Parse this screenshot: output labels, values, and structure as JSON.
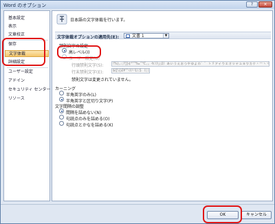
{
  "window": {
    "title": "Word のオプション",
    "help_label": "?",
    "close_label": "✕"
  },
  "sidebar": {
    "items": [
      {
        "label": "基本設定"
      },
      {
        "label": "表示"
      },
      {
        "label": "文章校正"
      },
      {
        "label": "保存"
      },
      {
        "label": "文字体裁"
      },
      {
        "label": "詳細設定"
      },
      {
        "label": "ユーザー設定"
      },
      {
        "label": "アドイン"
      },
      {
        "label": "セキュリティ センター"
      },
      {
        "label": "リソース"
      }
    ],
    "selected_index": 4
  },
  "content": {
    "header_text": "日本語の文字体裁を行います。",
    "section_label": "文字体裁オプションの適用先(E):",
    "apply_to": {
      "value": "文書 1",
      "icon": "document-icon"
    },
    "kinsoku": {
      "group_label": "禁則文字の設定",
      "level_label": "高レベル(I)",
      "custom_label": "ユーザー設定(U)",
      "line_start_label": "行頭禁則文字(S):",
      "line_start_value": "!%),.:;?]}¢°’”‰′″℃、。々〉》」』】〕ぁぃぅぇぉっゃゅょゎ゛゜ゝゞァィゥェォッャュョヮヵヶ・ーヽヾ！％），．：；？］｝｡｣､･ｧｨｩｪｫｬｭｮｯｰﾞﾟ￠",
      "line_end_label": "行末禁則文字(E):",
      "line_end_value": "$([\\{£¥‘“〈《「『【〔＄（［｛｢￡￥",
      "notice": "禁則文字は変更されていません。"
    },
    "kerning": {
      "group_label": "カーニング",
      "option1": "半角英字のみ(L)",
      "option2": "半角英字と区切り文字(P)"
    },
    "compression": {
      "group_label": "文字間隔の調整",
      "option1": "間隔を詰めない(N)",
      "option2": "句読点のみを詰める(O)",
      "option3": "句読点とかなを詰める(K)"
    }
  },
  "footer": {
    "ok_label": "OK",
    "cancel_label": "キャンセル"
  },
  "colors": {
    "highlight": "#e01515",
    "selected_bg": "#f5c76c",
    "accent": "#1d4e9a"
  }
}
